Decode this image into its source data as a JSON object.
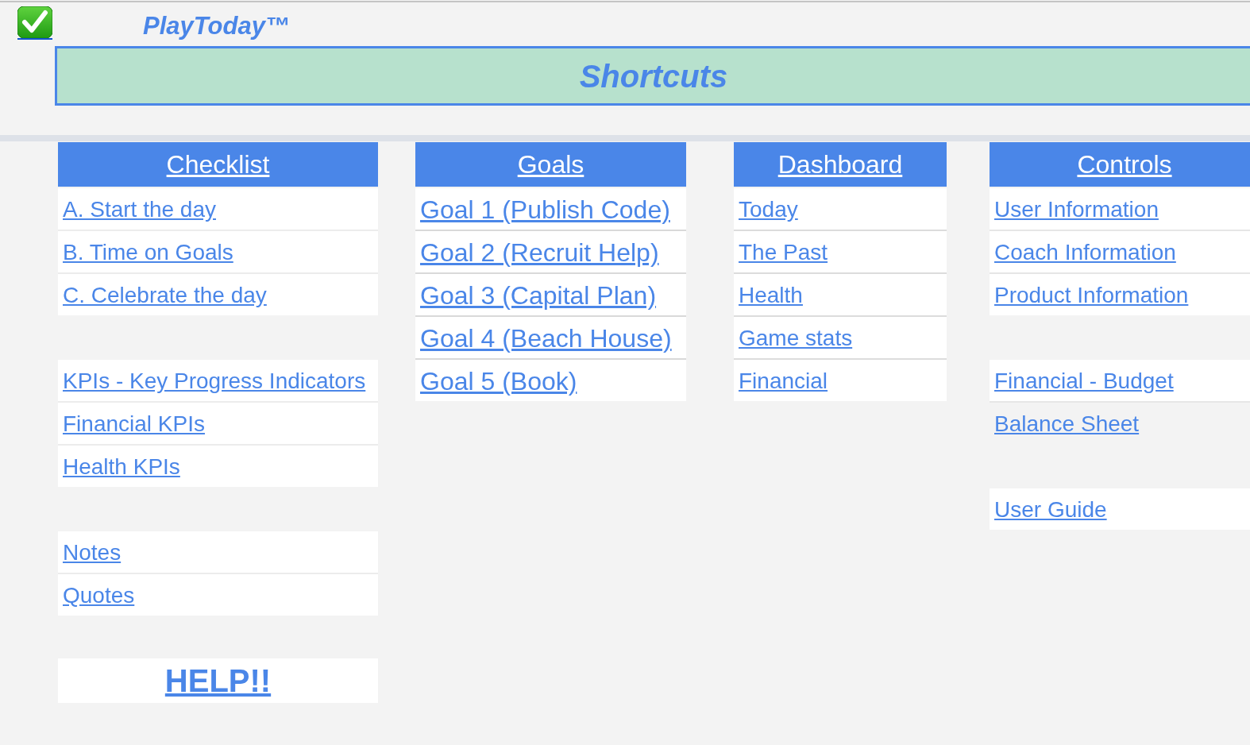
{
  "header": {
    "title": "PlayToday™"
  },
  "banner": {
    "title": "Shortcuts"
  },
  "columns": [
    {
      "heading": "Checklist",
      "groups": [
        {
          "links": [
            {
              "label": "A. Start the day"
            },
            {
              "label": "B. Time on Goals"
            },
            {
              "label": "C. Celebrate the day"
            }
          ]
        },
        {
          "links": [
            {
              "label": "KPIs - Key Progress Indicators"
            },
            {
              "label": "Financial KPIs"
            },
            {
              "label": "Health KPIs"
            }
          ]
        },
        {
          "links": [
            {
              "label": "Notes"
            },
            {
              "label": "Quotes"
            }
          ]
        }
      ],
      "help": "HELP!!"
    },
    {
      "heading": "Goals",
      "groups": [
        {
          "links": [
            {
              "label": "Goal 1 (Publish Code)"
            },
            {
              "label": "Goal 2 (Recruit Help)"
            },
            {
              "label": "Goal 3 (Capital Plan)"
            },
            {
              "label": "Goal 4 (Beach House)"
            },
            {
              "label": "Goal 5 (Book)"
            }
          ]
        }
      ]
    },
    {
      "heading": "Dashboard",
      "groups": [
        {
          "links": [
            {
              "label": "Today"
            },
            {
              "label": "The Past"
            },
            {
              "label": "Health"
            },
            {
              "label": "Game stats"
            },
            {
              "label": "Financial"
            }
          ]
        }
      ]
    },
    {
      "heading": "Controls",
      "groups": [
        {
          "links": [
            {
              "label": "User Information"
            },
            {
              "label": "Coach Information"
            },
            {
              "label": "Product Information"
            }
          ]
        },
        {
          "links": [
            {
              "label": "Financial - Budget",
              "kind": "cell"
            },
            {
              "label": "Balance Sheet",
              "kind": "bare"
            }
          ]
        },
        {
          "links": [
            {
              "label": "User Guide"
            }
          ]
        }
      ]
    }
  ]
}
